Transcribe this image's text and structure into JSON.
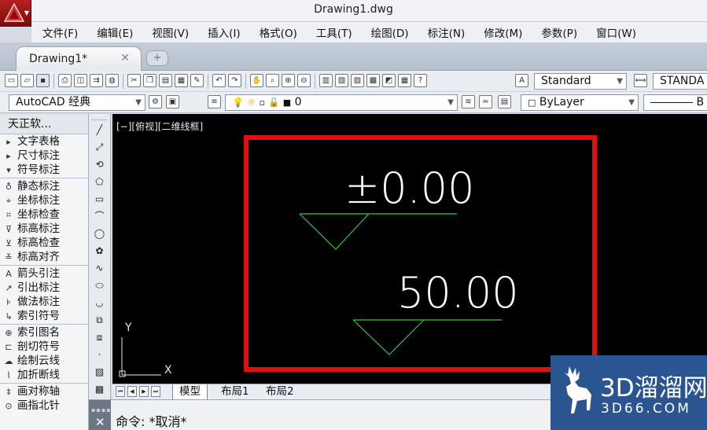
{
  "window": {
    "title": "Drawing1.dwg"
  },
  "menu": [
    "文件(F)",
    "编辑(E)",
    "视图(V)",
    "插入(I)",
    "格式(O)",
    "工具(T)",
    "绘图(D)",
    "标注(N)",
    "修改(M)",
    "参数(P)",
    "窗口(W)"
  ],
  "tabs": {
    "active": "Drawing1*",
    "close_glyph": "✕",
    "new_glyph": "+"
  },
  "toolbar": {
    "text_style": "Standard",
    "dim_style": "STANDA",
    "workspace": "AutoCAD 经典",
    "layer": "0",
    "color": "ByLayer",
    "linetype_preview": "B"
  },
  "left_panel": {
    "title": "天正软...",
    "items": [
      {
        "label": "文字表格",
        "icon": "arrow-right-icon"
      },
      {
        "label": "尺寸标注",
        "icon": "arrow-right-icon"
      },
      {
        "label": "符号标注",
        "icon": "arrow-down-icon"
      },
      {
        "label": "静态标注",
        "icon": "bulb-icon"
      },
      {
        "label": "坐标标注",
        "icon": "coord-icon"
      },
      {
        "label": "坐标检查",
        "icon": "coord-check-icon"
      },
      {
        "label": "标高标注",
        "icon": "elevation-icon"
      },
      {
        "label": "标高检查",
        "icon": "elevation-check-icon"
      },
      {
        "label": "标高对齐",
        "icon": "elevation-align-icon"
      },
      {
        "label": "箭头引注",
        "icon": "arrow-leader-icon"
      },
      {
        "label": "引出标注",
        "icon": "leader-icon"
      },
      {
        "label": "做法标注",
        "icon": "note-icon"
      },
      {
        "label": "索引符号",
        "icon": "index-icon"
      },
      {
        "label": "索引图名",
        "icon": "index-name-icon"
      },
      {
        "label": "剖切符号",
        "icon": "section-icon"
      },
      {
        "label": "绘制云线",
        "icon": "cloud-icon"
      },
      {
        "label": "加折断线",
        "icon": "break-line-icon"
      },
      {
        "label": "画对称轴",
        "icon": "symmetry-icon"
      },
      {
        "label": "画指北针",
        "icon": "north-arrow-icon"
      }
    ]
  },
  "viewport": {
    "label": "[−][俯视][二维线框]"
  },
  "drawing": {
    "elevation_1": "±0.00",
    "elevation_2": "50.00",
    "ucs_y": "Y",
    "ucs_x": "X",
    "frame_color": "#e01010",
    "symbol_color": "#3cc43c",
    "text_color": "#ffffff"
  },
  "layout_tabs": [
    "模型",
    "布局1",
    "布局2"
  ],
  "command": {
    "text": "命令: *取消*"
  },
  "watermark": {
    "main": "3D溜溜网",
    "sub": "3D66.COM"
  }
}
